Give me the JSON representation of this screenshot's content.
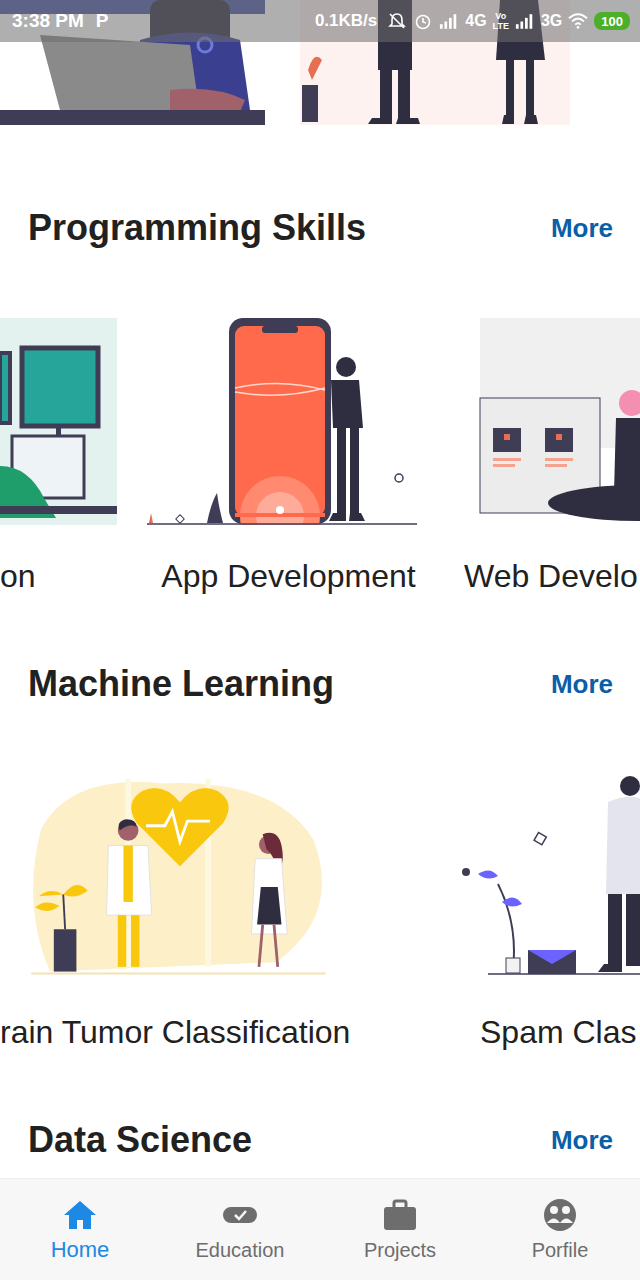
{
  "status_bar": {
    "time": "3:38 PM",
    "app_indicator": "P",
    "speed": "0.1KB/s",
    "network_primary": "4G",
    "volte_top": "Vo",
    "volte_bottom": "LTE",
    "network_secondary": "3G",
    "battery": "100"
  },
  "sections": [
    {
      "title": "Programming Skills",
      "more": "More",
      "items": [
        {
          "label": "on"
        },
        {
          "label": "App Development"
        },
        {
          "label": "Web Develo"
        }
      ]
    },
    {
      "title": "Machine Learning",
      "more": "More",
      "items": [
        {
          "label": "rain Tumor Classification"
        },
        {
          "label": "Spam Clas"
        }
      ]
    },
    {
      "title": "Data Science",
      "more": "More",
      "items": []
    }
  ],
  "bottom_nav": [
    {
      "label": "Home",
      "selected": true
    },
    {
      "label": "Education",
      "selected": false
    },
    {
      "label": "Projects",
      "selected": false
    },
    {
      "label": "Porfile",
      "selected": false
    }
  ]
}
